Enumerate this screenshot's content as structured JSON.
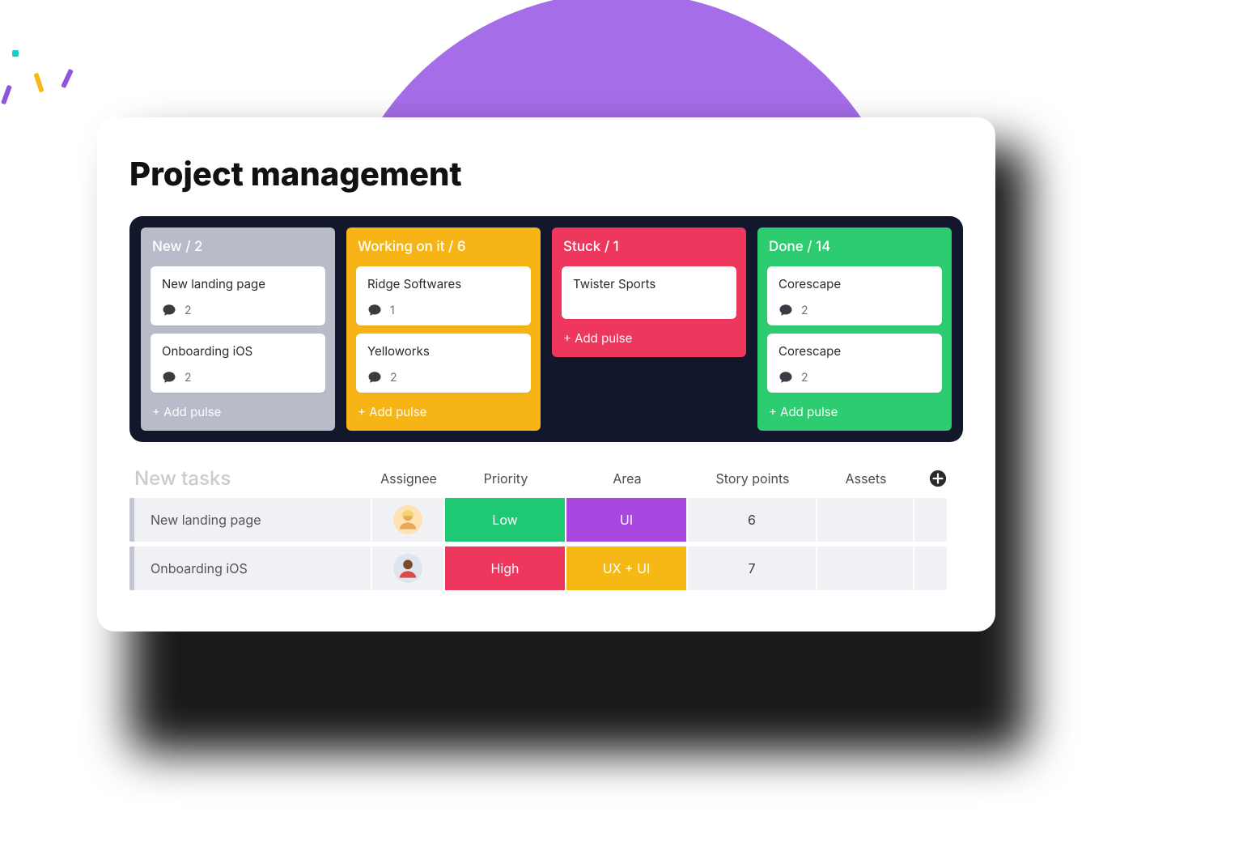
{
  "page": {
    "title": "Project management"
  },
  "colors": {
    "purple_bg": "#a66de8",
    "board_bg": "#12172b",
    "col_gray": "#b9bcc8",
    "col_yellow": "#f7b417",
    "col_red": "#ee375d",
    "col_green": "#2ecc71",
    "pill_green": "#1fc872",
    "pill_purple": "#aa47e0",
    "pill_yellow": "#f6b814"
  },
  "board": {
    "add_label": "+ Add pulse",
    "columns": [
      {
        "id": "new",
        "title": "New",
        "count": 2,
        "header": "New / 2",
        "color": "#b9bcc8",
        "cards": [
          {
            "title": "New landing page",
            "comments": 2
          },
          {
            "title": "Onboarding iOS",
            "comments": 2
          }
        ],
        "show_add": true
      },
      {
        "id": "working",
        "title": "Working on it",
        "count": 6,
        "header": "Working on it / 6",
        "color": "#f7b417",
        "cards": [
          {
            "title": "Ridge Softwares",
            "comments": 1
          },
          {
            "title": "Yelloworks",
            "comments": 2
          }
        ],
        "show_add": true
      },
      {
        "id": "stuck",
        "title": "Stuck",
        "count": 1,
        "header": "Stuck / 1",
        "color": "#ee375d",
        "cards": [
          {
            "title": "Twister Sports"
          }
        ],
        "show_add": true
      },
      {
        "id": "done",
        "title": "Done",
        "count": 14,
        "header": "Done / 14",
        "color": "#2ecc71",
        "cards": [
          {
            "title": "Corescape",
            "comments": 2
          },
          {
            "title": "Corescape",
            "comments": 2
          }
        ],
        "show_add": true
      }
    ]
  },
  "tasks": {
    "section_title": "New tasks",
    "headers": {
      "assignee": "Assignee",
      "priority": "Priority",
      "area": "Area",
      "points": "Story points",
      "assets": "Assets"
    },
    "rows": [
      {
        "name": "New landing page",
        "assignee_icon": "avatar-1",
        "priority": {
          "label": "Low",
          "color": "#1fc872"
        },
        "area": {
          "label": "UI",
          "color": "#aa47e0"
        },
        "points": 6,
        "assets": ""
      },
      {
        "name": "Onboarding iOS",
        "assignee_icon": "avatar-2",
        "priority": {
          "label": "High",
          "color": "#ee375d"
        },
        "area": {
          "label": "UX + UI",
          "color": "#f6b814"
        },
        "points": 7,
        "assets": ""
      }
    ]
  }
}
